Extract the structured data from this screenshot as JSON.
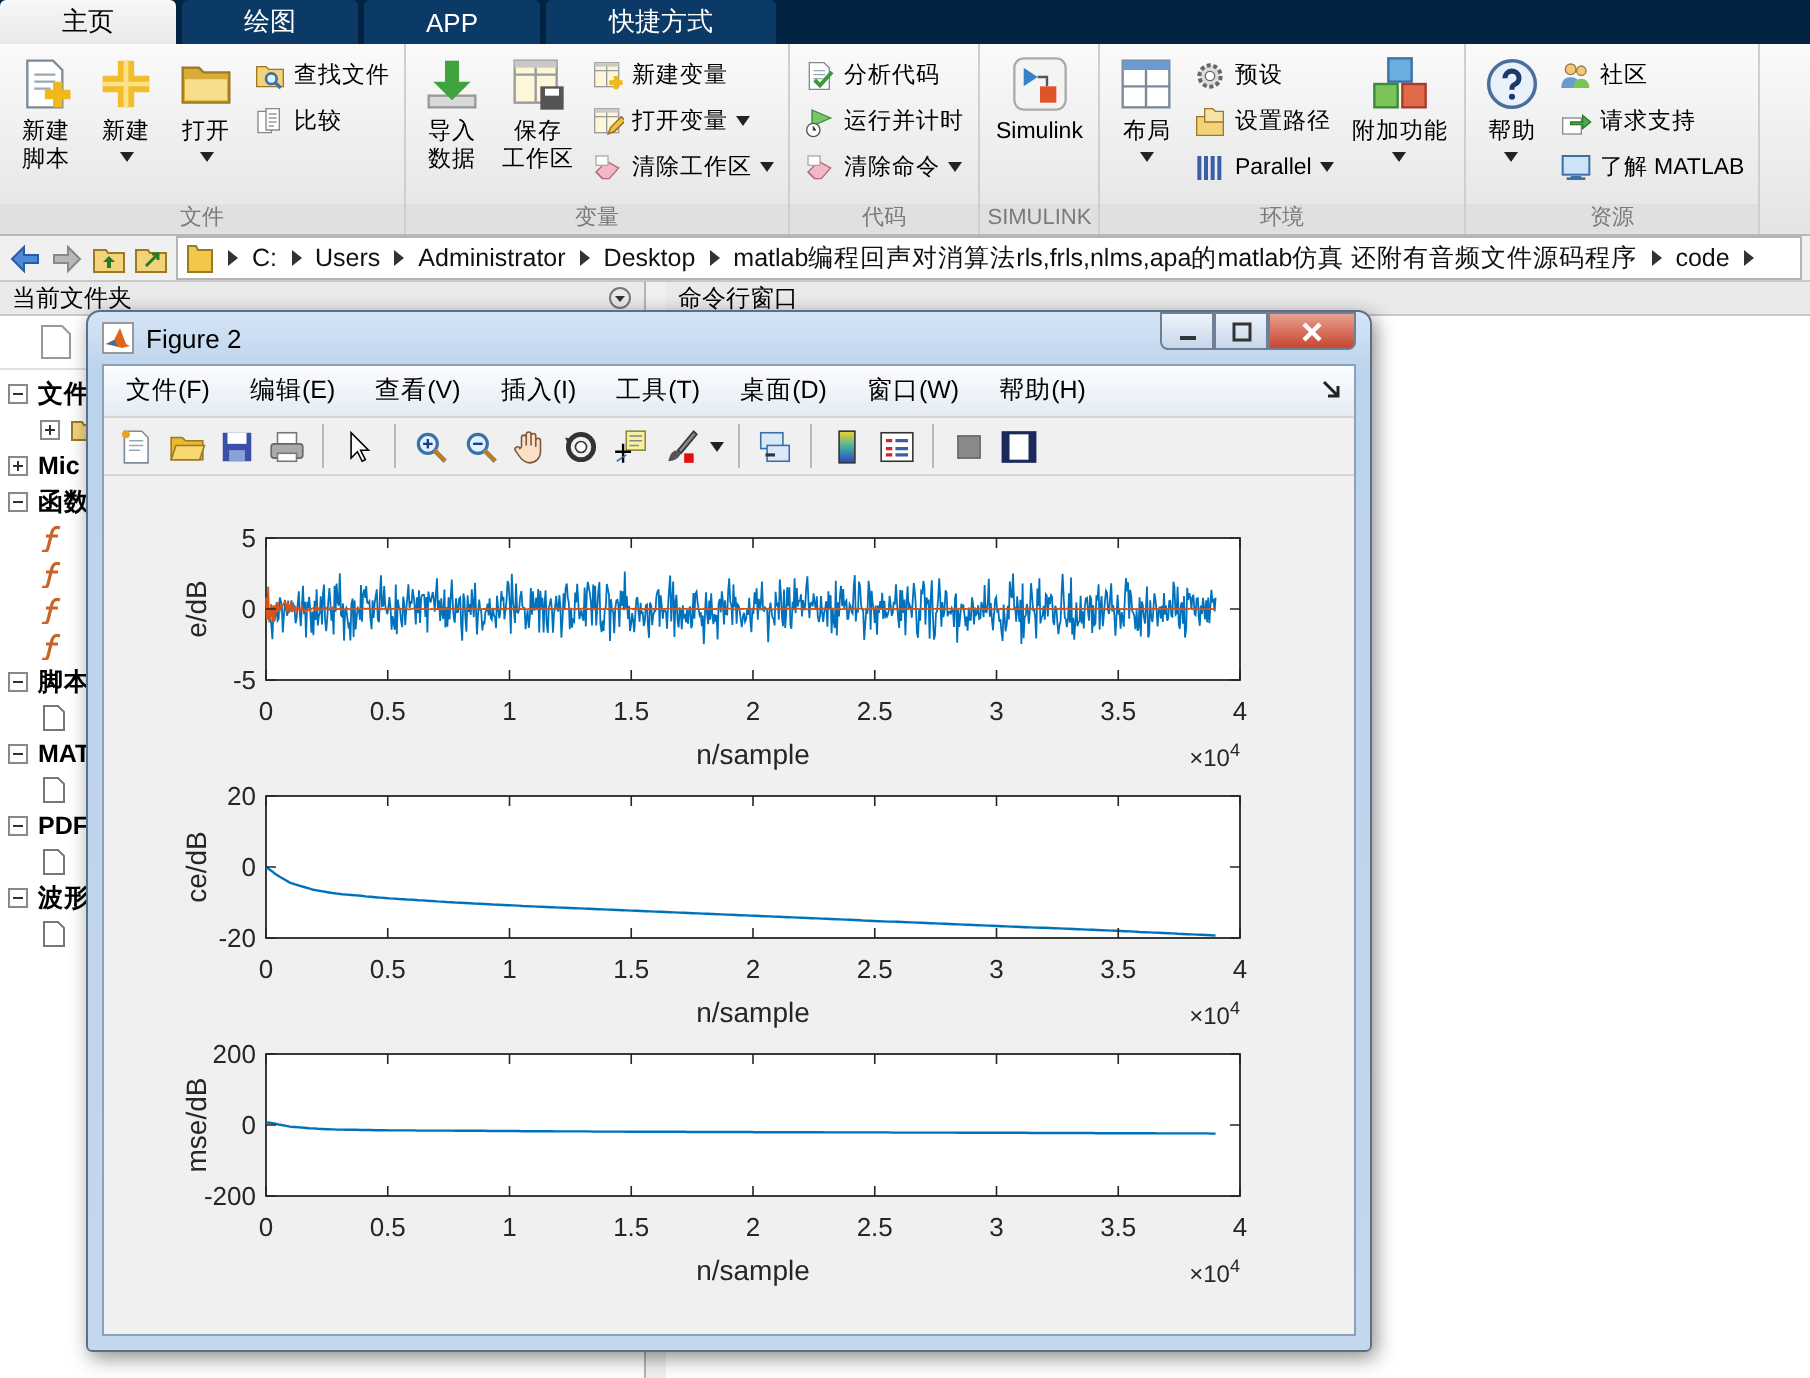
{
  "tabs": [
    {
      "label": "主页",
      "selected": true
    },
    {
      "label": "绘图",
      "selected": false
    },
    {
      "label": "APP",
      "selected": false
    },
    {
      "label": "快捷方式",
      "selected": false
    }
  ],
  "ribbon": {
    "sections": [
      {
        "label": "文件",
        "items": [
          {
            "kind": "large",
            "label": "新建脚本",
            "dropdown": false
          },
          {
            "kind": "large",
            "label": "新建",
            "dropdown": true
          },
          {
            "kind": "large",
            "label": "打开",
            "dropdown": true
          },
          {
            "kind": "stack",
            "buttons": [
              {
                "label": "查找文件",
                "dropdown": false
              },
              {
                "label": "比较",
                "dropdown": false
              }
            ]
          }
        ]
      },
      {
        "label": "变量",
        "items": [
          {
            "kind": "large",
            "label": "导入数据",
            "dropdown": false
          },
          {
            "kind": "large",
            "label": "保存工作区",
            "dropdown": false
          },
          {
            "kind": "stack",
            "buttons": [
              {
                "label": "新建变量",
                "dropdown": false
              },
              {
                "label": "打开变量",
                "dropdown": true
              },
              {
                "label": "清除工作区",
                "dropdown": true
              }
            ]
          }
        ]
      },
      {
        "label": "代码",
        "items": [
          {
            "kind": "stack",
            "buttons": [
              {
                "label": "分析代码",
                "dropdown": false
              },
              {
                "label": "运行并计时",
                "dropdown": false
              },
              {
                "label": "清除命令",
                "dropdown": true
              }
            ]
          }
        ]
      },
      {
        "label": "SIMULINK",
        "items": [
          {
            "kind": "large",
            "label": "Simulink",
            "dropdown": false
          }
        ]
      },
      {
        "label": "环境",
        "items": [
          {
            "kind": "large",
            "label": "布局",
            "dropdown": true
          },
          {
            "kind": "stack",
            "buttons": [
              {
                "label": "预设",
                "dropdown": false
              },
              {
                "label": "设置路径",
                "dropdown": false
              },
              {
                "label": "Parallel",
                "dropdown": true
              }
            ]
          },
          {
            "kind": "large",
            "label": "附加功能",
            "dropdown": true
          }
        ]
      },
      {
        "label": "资源",
        "items": [
          {
            "kind": "large",
            "label": "帮助",
            "dropdown": true
          },
          {
            "kind": "stack",
            "buttons": [
              {
                "label": "社区",
                "dropdown": false
              },
              {
                "label": "请求支持",
                "dropdown": false
              },
              {
                "label": "了解 MATLAB",
                "dropdown": false
              }
            ]
          }
        ]
      }
    ]
  },
  "address_bar": {
    "path": [
      "C:",
      "Users",
      "Administrator",
      "Desktop",
      "matlab编程回声对消算法rls,frls,nlms,apa的matlab仿真 还附有音频文件源码程序",
      "code"
    ]
  },
  "current_folder": {
    "title": "当前文件夹",
    "groups": [
      {
        "label": "文件",
        "expanded": true,
        "children": [
          {
            "kind": "folder",
            "expanded": false
          }
        ]
      },
      {
        "label": "Mic",
        "expanded": false
      },
      {
        "label": "函数",
        "expanded": true,
        "children": [
          {
            "kind": "function"
          },
          {
            "kind": "function"
          },
          {
            "kind": "function"
          },
          {
            "kind": "function"
          }
        ]
      },
      {
        "label": "脚本",
        "expanded": true,
        "children": [
          {
            "kind": "file"
          }
        ]
      },
      {
        "label": "MAT",
        "expanded": true,
        "children": [
          {
            "kind": "file"
          }
        ]
      },
      {
        "label": "PDF",
        "expanded": true,
        "children": [
          {
            "kind": "file"
          }
        ]
      },
      {
        "label": "波形",
        "expanded": true,
        "children": [
          {
            "kind": "file"
          }
        ]
      }
    ]
  },
  "command_window": {
    "title": "命令行窗口"
  },
  "figure": {
    "title": "Figure 2",
    "menu": [
      "文件(F)",
      "编辑(E)",
      "查看(V)",
      "插入(I)",
      "工具(T)",
      "桌面(D)",
      "窗口(W)",
      "帮助(H)"
    ],
    "plots": [
      {
        "kind": "noise",
        "axes": {
          "xlabel": "n/sample",
          "ylabel": "e/dB",
          "xticks": [
            "0",
            "0.5",
            "1",
            "1.5",
            "2",
            "2.5",
            "3",
            "3.5",
            "4"
          ],
          "yticks": [
            "5",
            "0",
            "-5"
          ]
        },
        "exponent_label": "×10$^{4}$"
      },
      {
        "kind": "curve",
        "chart_data": {
          "type": "line",
          "xlabel": "n/sample",
          "ylabel": "ce/dB",
          "xlim": [
            0,
            4
          ],
          "ylim": [
            -20,
            20
          ],
          "xticks": [
            0,
            0.5,
            1,
            1.5,
            2,
            2.5,
            3,
            3.5,
            4
          ],
          "yticks": [
            -20,
            0,
            20
          ],
          "x": [
            0,
            0.05,
            0.1,
            0.2,
            0.3,
            0.5,
            0.75,
            1,
            1.5,
            2,
            2.5,
            3,
            3.5,
            3.9
          ],
          "series": [
            {
              "color": "#0072bd",
              "values": [
                0,
                -2.5,
                -4.5,
                -6.5,
                -7.6,
                -8.8,
                -9.9,
                -10.8,
                -12.3,
                -13.7,
                -15.2,
                -16.6,
                -18,
                -19.3
              ]
            }
          ]
        },
        "exponent_label": "×10$^{4}$"
      },
      {
        "kind": "curve",
        "chart_data": {
          "type": "line",
          "xlabel": "n/sample",
          "ylabel": "mse/dB",
          "xlim": [
            0,
            4
          ],
          "ylim": [
            -200,
            200
          ],
          "xticks": [
            0,
            0.5,
            1,
            1.5,
            2,
            2.5,
            3,
            3.5,
            4
          ],
          "yticks": [
            -200,
            0,
            200
          ],
          "x": [
            0,
            0.05,
            0.1,
            0.2,
            0.3,
            0.5,
            1,
            1.5,
            2,
            2.5,
            3,
            3.5,
            3.9
          ],
          "series": [
            {
              "color": "#0072bd",
              "values": [
                8,
                2,
                -5,
                -10,
                -13,
                -15,
                -17,
                -19,
                -20,
                -21,
                -22,
                -23,
                -24
              ]
            }
          ]
        },
        "exponent_label": "×10$^{4}$"
      }
    ]
  }
}
